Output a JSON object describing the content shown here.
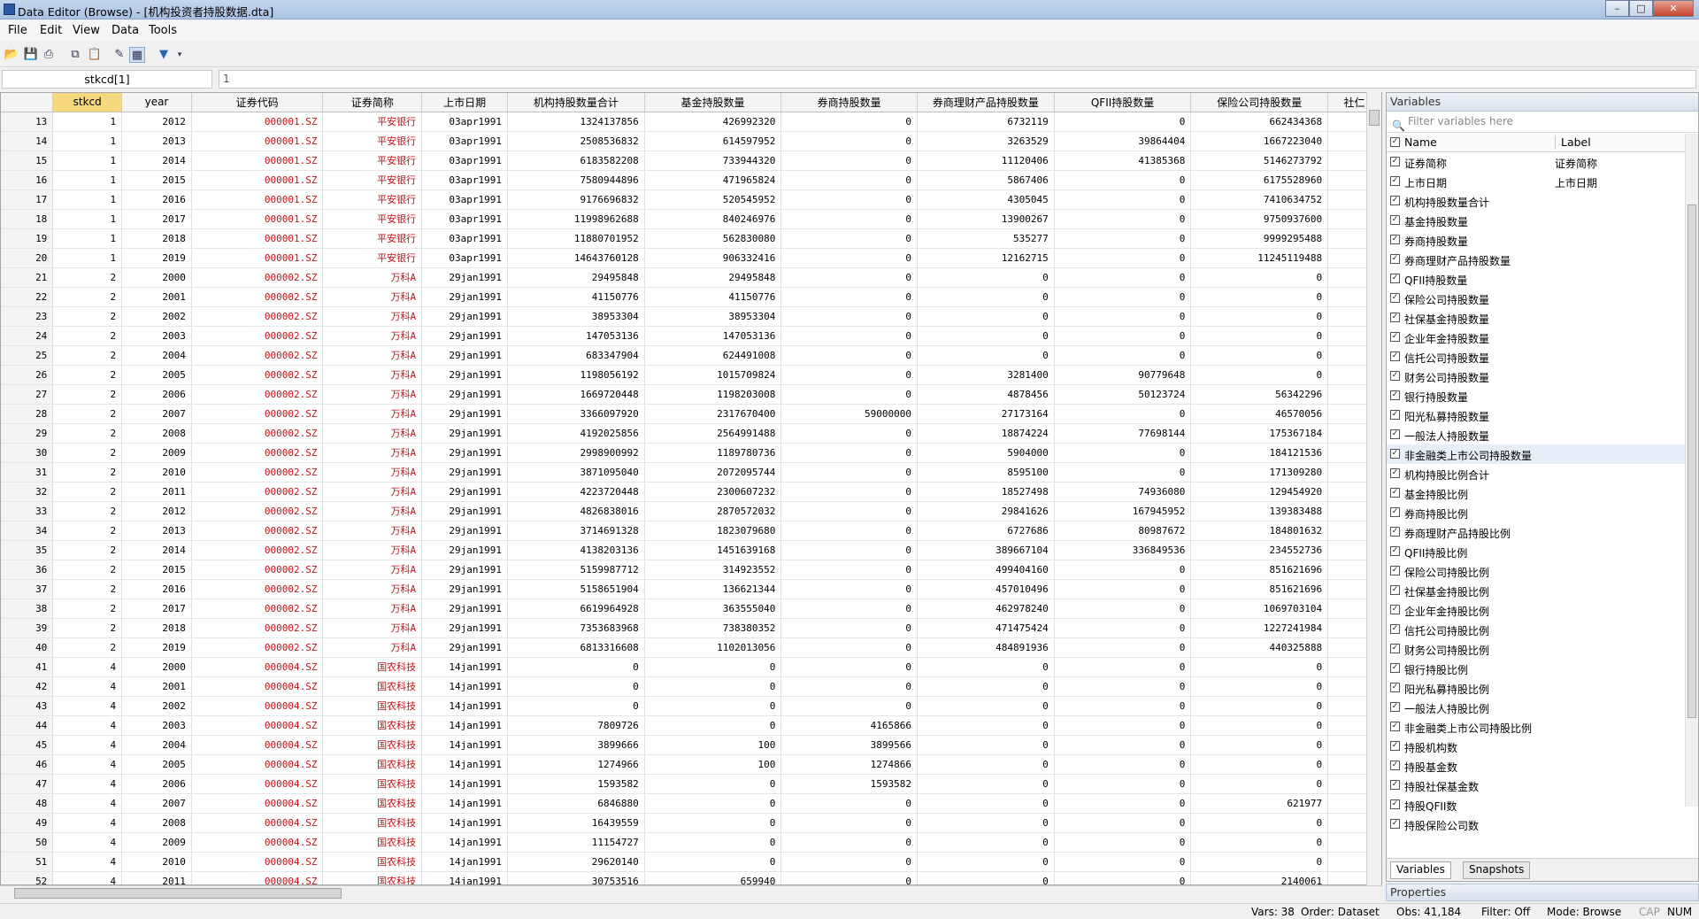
{
  "window": {
    "title": "Data Editor (Browse) - [机构投资者持股数据.dta]"
  },
  "menu": [
    "File",
    "Edit",
    "View",
    "Data",
    "Tools"
  ],
  "cellbar": {
    "varname": "stkcd[1]",
    "value": "1"
  },
  "grid": {
    "columns": [
      "stkcd",
      "year",
      "证券代码",
      "证券简称",
      "上市日期",
      "机构持股数量合计",
      "基金持股数量",
      "券商持股数量",
      "券商理财产品持股数量",
      "QFII持股数量",
      "保险公司持股数量",
      "社仁"
    ],
    "rows": [
      [
        "13",
        "1",
        "2012",
        "000001.SZ",
        "平安银行",
        "03apr1991",
        "1324137856",
        "426992320",
        "0",
        "6732119",
        "0",
        "662434368"
      ],
      [
        "14",
        "1",
        "2013",
        "000001.SZ",
        "平安银行",
        "03apr1991",
        "2508536832",
        "614597952",
        "0",
        "3263529",
        "39864404",
        "1667223040"
      ],
      [
        "15",
        "1",
        "2014",
        "000001.SZ",
        "平安银行",
        "03apr1991",
        "6183582208",
        "733944320",
        "0",
        "11120406",
        "41385368",
        "5146273792"
      ],
      [
        "16",
        "1",
        "2015",
        "000001.SZ",
        "平安银行",
        "03apr1991",
        "7580944896",
        "471965824",
        "0",
        "5867406",
        "0",
        "6175528960"
      ],
      [
        "17",
        "1",
        "2016",
        "000001.SZ",
        "平安银行",
        "03apr1991",
        "9176696832",
        "520545952",
        "0",
        "4305045",
        "0",
        "7410634752"
      ],
      [
        "18",
        "1",
        "2017",
        "000001.SZ",
        "平安银行",
        "03apr1991",
        "11998962688",
        "840246976",
        "0",
        "13900267",
        "0",
        "9750937600"
      ],
      [
        "19",
        "1",
        "2018",
        "000001.SZ",
        "平安银行",
        "03apr1991",
        "11880701952",
        "562830080",
        "0",
        "535277",
        "0",
        "9999295488"
      ],
      [
        "20",
        "1",
        "2019",
        "000001.SZ",
        "平安银行",
        "03apr1991",
        "14643760128",
        "906332416",
        "0",
        "12162715",
        "0",
        "11245119488"
      ],
      [
        "21",
        "2",
        "2000",
        "000002.SZ",
        "万科A",
        "29jan1991",
        "29495848",
        "29495848",
        "0",
        "0",
        "0",
        "0"
      ],
      [
        "22",
        "2",
        "2001",
        "000002.SZ",
        "万科A",
        "29jan1991",
        "41150776",
        "41150776",
        "0",
        "0",
        "0",
        "0"
      ],
      [
        "23",
        "2",
        "2002",
        "000002.SZ",
        "万科A",
        "29jan1991",
        "38953304",
        "38953304",
        "0",
        "0",
        "0",
        "0"
      ],
      [
        "24",
        "2",
        "2003",
        "000002.SZ",
        "万科A",
        "29jan1991",
        "147053136",
        "147053136",
        "0",
        "0",
        "0",
        "0"
      ],
      [
        "25",
        "2",
        "2004",
        "000002.SZ",
        "万科A",
        "29jan1991",
        "683347904",
        "624491008",
        "0",
        "0",
        "0",
        "0"
      ],
      [
        "26",
        "2",
        "2005",
        "000002.SZ",
        "万科A",
        "29jan1991",
        "1198056192",
        "1015709824",
        "0",
        "3281400",
        "90779648",
        "0"
      ],
      [
        "27",
        "2",
        "2006",
        "000002.SZ",
        "万科A",
        "29jan1991",
        "1669720448",
        "1198203008",
        "0",
        "4878456",
        "50123724",
        "56342296"
      ],
      [
        "28",
        "2",
        "2007",
        "000002.SZ",
        "万科A",
        "29jan1991",
        "3366097920",
        "2317670400",
        "59000000",
        "27173164",
        "0",
        "46570056"
      ],
      [
        "29",
        "2",
        "2008",
        "000002.SZ",
        "万科A",
        "29jan1991",
        "4192025856",
        "2564991488",
        "0",
        "18874224",
        "77698144",
        "175367184"
      ],
      [
        "30",
        "2",
        "2009",
        "000002.SZ",
        "万科A",
        "29jan1991",
        "2998900992",
        "1189780736",
        "0",
        "5904000",
        "0",
        "184121536"
      ],
      [
        "31",
        "2",
        "2010",
        "000002.SZ",
        "万科A",
        "29jan1991",
        "3871095040",
        "2072095744",
        "0",
        "8595100",
        "0",
        "171309280"
      ],
      [
        "32",
        "2",
        "2011",
        "000002.SZ",
        "万科A",
        "29jan1991",
        "4223720448",
        "2300607232",
        "0",
        "18527498",
        "74936080",
        "129454920"
      ],
      [
        "33",
        "2",
        "2012",
        "000002.SZ",
        "万科A",
        "29jan1991",
        "4826838016",
        "2870572032",
        "0",
        "29841626",
        "167945952",
        "139383488"
      ],
      [
        "34",
        "2",
        "2013",
        "000002.SZ",
        "万科A",
        "29jan1991",
        "3714691328",
        "1823079680",
        "0",
        "6727686",
        "80987672",
        "184801632"
      ],
      [
        "35",
        "2",
        "2014",
        "000002.SZ",
        "万科A",
        "29jan1991",
        "4138203136",
        "1451639168",
        "0",
        "389667104",
        "336849536",
        "234552736"
      ],
      [
        "36",
        "2",
        "2015",
        "000002.SZ",
        "万科A",
        "29jan1991",
        "5159987712",
        "314923552",
        "0",
        "499404160",
        "0",
        "851621696"
      ],
      [
        "37",
        "2",
        "2016",
        "000002.SZ",
        "万科A",
        "29jan1991",
        "5158651904",
        "136621344",
        "0",
        "457010496",
        "0",
        "851621696"
      ],
      [
        "38",
        "2",
        "2017",
        "000002.SZ",
        "万科A",
        "29jan1991",
        "6619964928",
        "363555040",
        "0",
        "462978240",
        "0",
        "1069703104"
      ],
      [
        "39",
        "2",
        "2018",
        "000002.SZ",
        "万科A",
        "29jan1991",
        "7353683968",
        "738380352",
        "0",
        "471475424",
        "0",
        "1227241984"
      ],
      [
        "40",
        "2",
        "2019",
        "000002.SZ",
        "万科A",
        "29jan1991",
        "6813316608",
        "1102013056",
        "0",
        "484891936",
        "0",
        "440325888"
      ],
      [
        "41",
        "4",
        "2000",
        "000004.SZ",
        "国农科技",
        "14jan1991",
        "0",
        "0",
        "0",
        "0",
        "0",
        "0"
      ],
      [
        "42",
        "4",
        "2001",
        "000004.SZ",
        "国农科技",
        "14jan1991",
        "0",
        "0",
        "0",
        "0",
        "0",
        "0"
      ],
      [
        "43",
        "4",
        "2002",
        "000004.SZ",
        "国农科技",
        "14jan1991",
        "0",
        "0",
        "0",
        "0",
        "0",
        "0"
      ],
      [
        "44",
        "4",
        "2003",
        "000004.SZ",
        "国农科技",
        "14jan1991",
        "7809726",
        "0",
        "4165866",
        "0",
        "0",
        "0"
      ],
      [
        "45",
        "4",
        "2004",
        "000004.SZ",
        "国农科技",
        "14jan1991",
        "3899666",
        "100",
        "3899566",
        "0",
        "0",
        "0"
      ],
      [
        "46",
        "4",
        "2005",
        "000004.SZ",
        "国农科技",
        "14jan1991",
        "1274966",
        "100",
        "1274866",
        "0",
        "0",
        "0"
      ],
      [
        "47",
        "4",
        "2006",
        "000004.SZ",
        "国农科技",
        "14jan1991",
        "1593582",
        "0",
        "1593582",
        "0",
        "0",
        "0"
      ],
      [
        "48",
        "4",
        "2007",
        "000004.SZ",
        "国农科技",
        "14jan1991",
        "6846880",
        "0",
        "0",
        "0",
        "0",
        "621977"
      ],
      [
        "49",
        "4",
        "2008",
        "000004.SZ",
        "国农科技",
        "14jan1991",
        "16439559",
        "0",
        "0",
        "0",
        "0",
        "0"
      ],
      [
        "50",
        "4",
        "2009",
        "000004.SZ",
        "国农科技",
        "14jan1991",
        "11154727",
        "0",
        "0",
        "0",
        "0",
        "0"
      ],
      [
        "51",
        "4",
        "2010",
        "000004.SZ",
        "国农科技",
        "14jan1991",
        "29620140",
        "0",
        "0",
        "0",
        "0",
        "0"
      ],
      [
        "52",
        "4",
        "2011",
        "000004.SZ",
        "国农科技",
        "14jan1991",
        "30753516",
        "659940",
        "0",
        "0",
        "0",
        "2140061"
      ]
    ]
  },
  "variables_panel": {
    "title": "Variables",
    "filter_placeholder": "Filter variables here",
    "header_name": "Name",
    "header_label": "Label",
    "items": [
      {
        "name": "证券简称",
        "label": "证券简称"
      },
      {
        "name": "上市日期",
        "label": "上市日期"
      },
      {
        "name": "机构持股数量合计",
        "label": ""
      },
      {
        "name": "基金持股数量",
        "label": ""
      },
      {
        "name": "券商持股数量",
        "label": ""
      },
      {
        "name": "券商理财产品持股数量",
        "label": ""
      },
      {
        "name": "QFII持股数量",
        "label": ""
      },
      {
        "name": "保险公司持股数量",
        "label": ""
      },
      {
        "name": "社保基金持股数量",
        "label": ""
      },
      {
        "name": "企业年金持股数量",
        "label": ""
      },
      {
        "name": "信托公司持股数量",
        "label": ""
      },
      {
        "name": "财务公司持股数量",
        "label": ""
      },
      {
        "name": "银行持股数量",
        "label": ""
      },
      {
        "name": "阳光私募持股数量",
        "label": ""
      },
      {
        "name": "一般法人持股数量",
        "label": ""
      },
      {
        "name": "非金融类上市公司持股数量",
        "label": ""
      },
      {
        "name": "机构持股比例合计",
        "label": ""
      },
      {
        "name": "基金持股比例",
        "label": ""
      },
      {
        "name": "券商持股比例",
        "label": ""
      },
      {
        "name": "券商理财产品持股比例",
        "label": ""
      },
      {
        "name": "QFII持股比例",
        "label": ""
      },
      {
        "name": "保险公司持股比例",
        "label": ""
      },
      {
        "name": "社保基金持股比例",
        "label": ""
      },
      {
        "name": "企业年金持股比例",
        "label": ""
      },
      {
        "name": "信托公司持股比例",
        "label": ""
      },
      {
        "name": "财务公司持股比例",
        "label": ""
      },
      {
        "name": "银行持股比例",
        "label": ""
      },
      {
        "name": "阳光私募持股比例",
        "label": ""
      },
      {
        "name": "一般法人持股比例",
        "label": ""
      },
      {
        "name": "非金融类上市公司持股比例",
        "label": ""
      },
      {
        "name": "持股机构数",
        "label": ""
      },
      {
        "name": "持股基金数",
        "label": ""
      },
      {
        "name": "持股社保基金数",
        "label": ""
      },
      {
        "name": "持股QFII数",
        "label": ""
      },
      {
        "name": "持股保险公司数",
        "label": ""
      }
    ],
    "tabs": [
      "Variables",
      "Snapshots"
    ]
  },
  "properties_title": "Properties",
  "status": {
    "vars": "Vars: 38",
    "order": "Order: Dataset",
    "obs": "Obs: 41,184",
    "filter": "Filter: Off",
    "mode": "Mode: Browse",
    "cap": "CAP",
    "num": "NUM"
  },
  "colors": {
    "string_red": "#c0141c",
    "selected_header": "#f6d97e"
  }
}
